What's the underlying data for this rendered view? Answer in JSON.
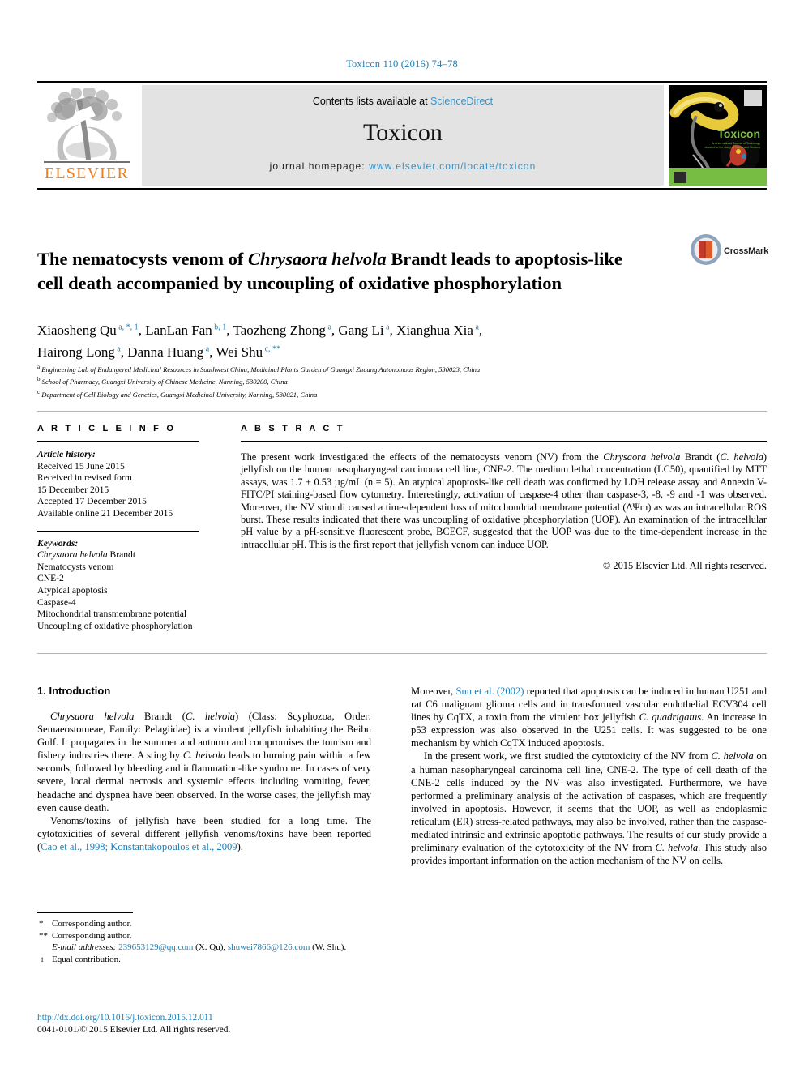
{
  "running_head": "Toxicon 110 (2016) 74–78",
  "masthead": {
    "contents_prefix": "Contents lists available at ",
    "sciencedirect": "ScienceDirect",
    "journal_name": "Toxicon",
    "homepage_label": "journal homepage: ",
    "homepage_url": "www.elsevier.com/locate/toxicon",
    "publisher_logo_text": "ELSEVIER",
    "cover_title": "Toxicon",
    "cover_subtitle": "An International Journal of Toxinology devoted to the study of Toxins and Venoms",
    "accent_blue": "#3b92c4",
    "elsevier_orange": "#ef7d1a",
    "cover_green": "#78bd43"
  },
  "article": {
    "title_part1": "The nematocysts venom of ",
    "title_italic": "Chrysaora helvola",
    "title_part2": " Brandt leads to apoptosis-like cell death accompanied by uncoupling of oxidative phosphorylation",
    "crossmark_label": "CrossMark",
    "authors_line1": "Xiaosheng Qu a, *, 1, LanLan Fan b, 1, Taozheng Zhong a, Gang Li a, Xianghua Xia a,",
    "authors_line2": "Hairong Long a, Danna Huang a, Wei Shu c, **",
    "authors": [
      {
        "name": "Xiaosheng Qu",
        "marks": "a, *, 1",
        "sep": ", "
      },
      {
        "name": "LanLan Fan",
        "marks": "b, 1",
        "sep": ", "
      },
      {
        "name": "Taozheng Zhong",
        "marks": "a",
        "sep": ", "
      },
      {
        "name": "Gang Li",
        "marks": "a",
        "sep": ", "
      },
      {
        "name": "Xianghua Xia",
        "marks": "a",
        "sep": ","
      },
      {
        "name": "Hairong Long",
        "marks": "a",
        "sep": ", "
      },
      {
        "name": "Danna Huang",
        "marks": "a",
        "sep": ", "
      },
      {
        "name": "Wei Shu",
        "marks": "c, **",
        "sep": ""
      }
    ],
    "affiliations": [
      {
        "mark": "a",
        "text": "Engineering Lab of Endangered Medicinal Resources in Southwest China, Medicinal Plants Garden of Guangxi Zhuang Autonomous Region, 530023, China"
      },
      {
        "mark": "b",
        "text": "School of Pharmacy, Guangxi University of Chinese Medicine, Nanning, 530200, China"
      },
      {
        "mark": "c",
        "text": "Department of Cell Biology and Genetics, Guangxi Medicinal University, Nanning, 530021, China"
      }
    ]
  },
  "article_info": {
    "heading": "A R T I C L E   I N F O",
    "history_label": "Article history:",
    "history": [
      "Received 15 June 2015",
      "Received in revised form",
      "15 December 2015",
      "Accepted 17 December 2015",
      "Available online 21 December 2015"
    ],
    "keywords_label": "Keywords:",
    "keywords": [
      "Chrysaora helvola Brandt",
      "Nematocysts venom",
      "CNE-2",
      "Atypical apoptosis",
      "Caspase-4",
      "Mitochondrial transmembrane potential",
      "Uncoupling of oxidative phosphorylation"
    ]
  },
  "abstract": {
    "heading": "A B S T R A C T",
    "text_a": "The present work investigated the effects of the nematocysts venom (NV) from the ",
    "text_italic_1": "Chrysaora helvola",
    "text_b": " Brandt (",
    "text_italic_2": "C. helvola",
    "text_c": ") jellyfish on the human nasopharyngeal carcinoma cell line, CNE-2. The medium lethal concentration (LC50), quantified by MTT assays, was 1.7 ± 0.53 µg/mL (n = 5). An atypical apoptosis-like cell death was confirmed by LDH release assay and Annexin V-FITC/PI staining-based flow cytometry. Interestingly, activation of caspase-4 other than caspase-3, -8, -9 and -1 was observed. Moreover, the NV stimuli caused a time-dependent loss of mitochondrial membrane potential (ΔΨm) as was an intracellular ROS burst. These results indicated that there was uncoupling of oxidative phosphorylation (UOP). An examination of the intracellular pH value by a pH-sensitive fluorescent probe, BCECF, suggested that the UOP was due to the time-dependent increase in the intracellular pH. This is the first report that jellyfish venom can induce UOP.",
    "copyright": "© 2015 Elsevier Ltd. All rights reserved."
  },
  "introduction": {
    "heading": "1. Introduction",
    "left_p1_italic_1": "Chrysaora helvola",
    "left_p1_a": " Brandt (",
    "left_p1_italic_2": "C. helvola",
    "left_p1_b": ") (Class: Scyphozoa, Order: Semaeostomeae, Family: Pelagiidae) is a virulent jellyfish inhabiting the Beibu Gulf. It propagates in the summer and autumn and compromises the tourism and fishery industries there. A sting by ",
    "left_p1_italic_3": "C. helvola",
    "left_p1_c": " leads to burning pain within a few seconds, followed by bleeding and inflammation-like syndrome. In cases of very severe, local dermal necrosis and systemic effects including vomiting, fever, headache and dyspnea have been observed. In the worse cases, the jellyfish may even cause death.",
    "left_p2_a": "Venoms/toxins of jellyfish have been studied for a long time. The cytotoxicities of several different jellyfish venoms/toxins have been reported (",
    "left_p2_cite": "Cao et al., 1998; Konstantakopoulos et al., 2009",
    "left_p2_b": ").",
    "right_p1_a": "Moreover, ",
    "right_p1_cite": "Sun et al. (2002)",
    "right_p1_b": " reported that apoptosis can be induced in human U251 and rat C6 malignant glioma cells and in transformed vascular endothelial ECV304 cell lines by CqTX, a toxin from the virulent box jellyfish ",
    "right_p1_italic": "C. quadrigatus",
    "right_p1_c": ". An increase in p53 expression was also observed in the U251 cells. It was suggested to be one mechanism by which CqTX induced apoptosis.",
    "right_p2_a": "In the present work, we first studied the cytotoxicity of the NV from ",
    "right_p2_italic_1": "C. helvola",
    "right_p2_b": " on a human nasopharyngeal carcinoma cell line, CNE-2. The type of cell death of the CNE-2 cells induced by the NV was also investigated. Furthermore, we have performed a preliminary analysis of the activation of caspases, which are frequently involved in apoptosis. However, it seems that the UOP, as well as endoplasmic reticulum (ER) stress-related pathways, may also be involved, rather than the caspase-mediated intrinsic and extrinsic apoptotic pathways. The results of our study provide a preliminary evaluation of the cytotoxicity of the NV from ",
    "right_p2_italic_2": "C. helvola",
    "right_p2_c": ". This study also provides important information on the action mechanism of the NV on cells."
  },
  "footnotes": {
    "corr1": "Corresponding author.",
    "corr2": "Corresponding author.",
    "email_label": "E-mail addresses:",
    "email1": "239653129@qq.com",
    "email1_owner": " (X. Qu), ",
    "email2": "shuwei7866@126.com",
    "email2_owner": " (W. Shu).",
    "equal": "Equal contribution.",
    "mark_star": "*",
    "mark_dstar": "**",
    "mark_one": "1"
  },
  "footer": {
    "doi": "http://dx.doi.org/10.1016/j.toxicon.2015.12.011",
    "issn_line": "0041-0101/© 2015 Elsevier Ltd. All rights reserved."
  }
}
